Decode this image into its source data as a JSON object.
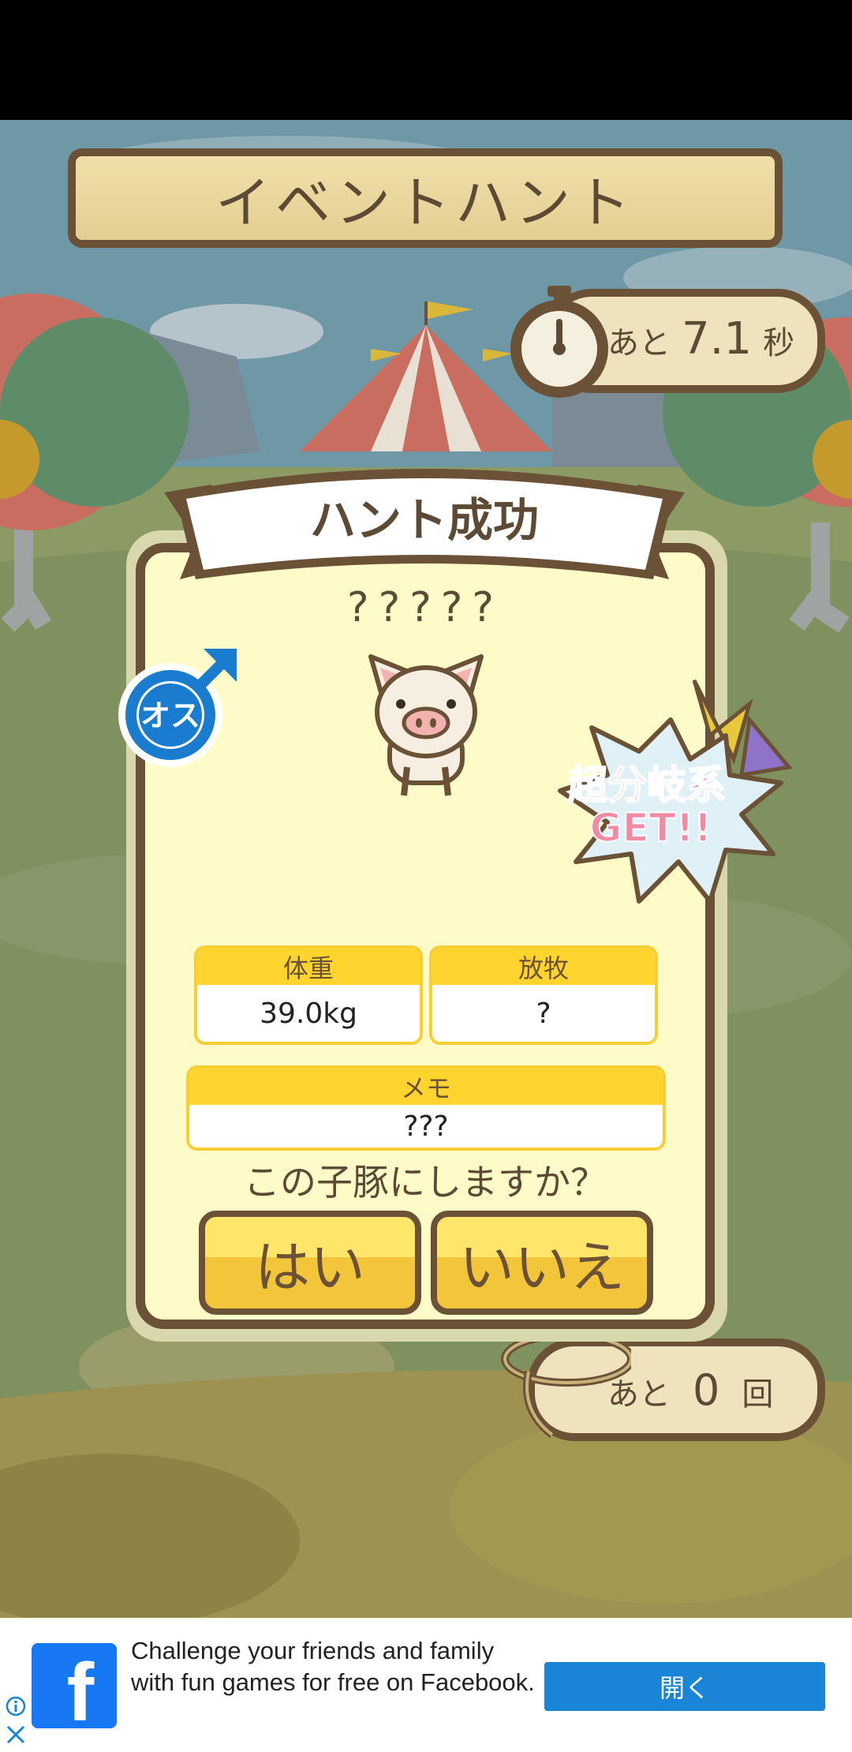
{
  "header": {
    "title": "イベントハント"
  },
  "timer": {
    "prefix": "あと",
    "value": "7.1",
    "unit": "秒"
  },
  "remaining": {
    "prefix": "あと",
    "value": "0",
    "unit": "回"
  },
  "dialog": {
    "title": "ハント成功",
    "gender_badge": "オス",
    "pig_name": "?????",
    "burst_line1": "超分岐系",
    "burst_line2": "GET!!",
    "weight_label": "体重",
    "weight_value": "39.0kg",
    "pasture_label": "放牧",
    "pasture_value": "?",
    "memo_label": "メモ",
    "memo_value": "???",
    "question": "この子豚にしますか？",
    "yes_label": "はい",
    "no_label": "いいえ"
  },
  "ad": {
    "text": "Challenge your friends and family with fun games for free on Facebook.",
    "button_label": "開く",
    "logo_letter": "f"
  },
  "colors": {
    "wood_border": "#6b5237",
    "dialog_bg": "#fffbc8",
    "field_header": "#ffd42e",
    "male_blue": "#1a7ccf",
    "ad_button": "#1a84d6",
    "facebook_blue": "#1877f2"
  }
}
